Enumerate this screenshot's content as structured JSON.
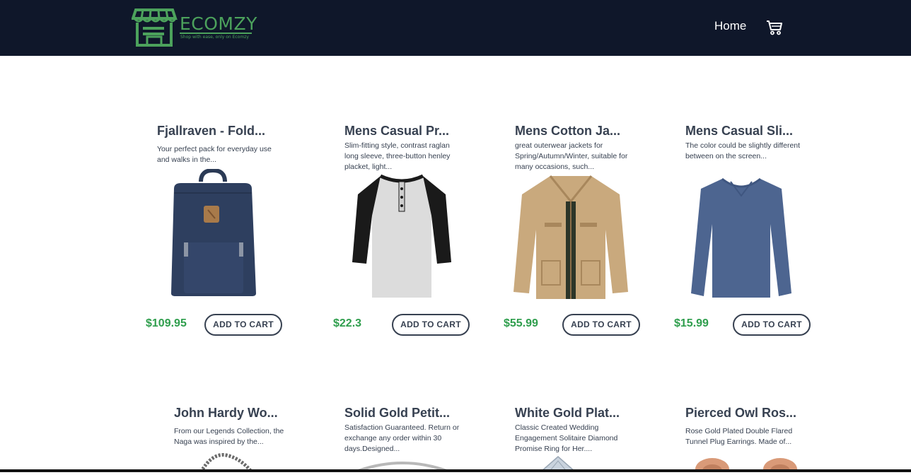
{
  "brand": {
    "name": "ECOMZY",
    "tagline": "Shop with ease, only on Ecomzy"
  },
  "nav": {
    "home_label": "Home",
    "cart_icon": "cart-icon"
  },
  "colors": {
    "navbar": "#0f172a",
    "brand": "#4ca25c",
    "price": "#2f9e4d",
    "text": "#374151"
  },
  "products": [
    {
      "title": "Fjallraven - Fold...",
      "description": "Your perfect pack for everyday use and walks in the...",
      "price": "$109.95",
      "button": "ADD TO CART",
      "image_icon": "backpack-image"
    },
    {
      "title": "Mens Casual Pr...",
      "description": "Slim-fitting style, contrast raglan long sleeve, three-button henley placket, light...",
      "price": "$22.3",
      "button": "ADD TO CART",
      "image_icon": "raglan-shirt-image"
    },
    {
      "title": "Mens Cotton Ja...",
      "description": "great outerwear jackets for Spring/Autumn/Winter, suitable for many occasions, such...",
      "price": "$55.99",
      "button": "ADD TO CART",
      "image_icon": "jacket-image"
    },
    {
      "title": "Mens Casual Sli...",
      "description": "The color could be slightly different between on the screen...",
      "price": "$15.99",
      "button": "ADD TO CART",
      "image_icon": "long-sleeve-shirt-image"
    },
    {
      "title": "John Hardy Wo...",
      "description": "From our Legends Collection, the Naga was inspired by the...",
      "image_icon": "bracelet-image"
    },
    {
      "title": "Solid Gold Petit...",
      "description": "Satisfaction Guaranteed. Return or exchange any order within 30 days.Designed...",
      "image_icon": "ring-image"
    },
    {
      "title": "White Gold Plat...",
      "description": "Classic Created Wedding Engagement Solitaire Diamond Promise Ring for Her....",
      "image_icon": "diamond-ring-image"
    },
    {
      "title": "Pierced Owl Ros...",
      "description": "Rose Gold Plated Double Flared Tunnel Plug Earrings. Made of...",
      "image_icon": "earrings-image"
    }
  ]
}
